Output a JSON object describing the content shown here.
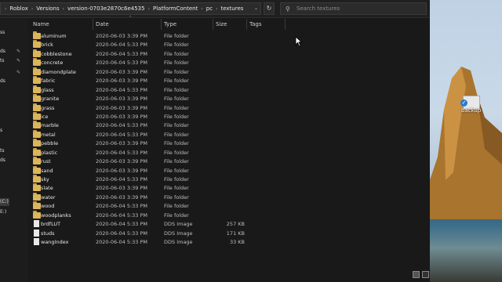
{
  "address": {
    "segments": [
      "Roblox",
      "Versions",
      "version-0703e2870c6e4535",
      "PlatformContent",
      "pc",
      "textures"
    ]
  },
  "search": {
    "placeholder": "Search textures"
  },
  "columns": {
    "name": "Name",
    "date": "Date",
    "type": "Type",
    "size": "Size",
    "tags": "Tags"
  },
  "nav": {
    "items": [
      "ss",
      "ds",
      "ts",
      "ds",
      "s",
      "ts",
      "ds",
      "(C:)",
      "E:)"
    ]
  },
  "desktop": {
    "icon_label": "backup"
  },
  "files": [
    {
      "name": "aluminum",
      "date": "2020-06-03 3:39 PM",
      "type": "File folder",
      "size": "",
      "kind": "folder"
    },
    {
      "name": "brick",
      "date": "2020-06-04 5:33 PM",
      "type": "File folder",
      "size": "",
      "kind": "folder"
    },
    {
      "name": "cobblestone",
      "date": "2020-06-04 5:33 PM",
      "type": "File folder",
      "size": "",
      "kind": "folder"
    },
    {
      "name": "concrete",
      "date": "2020-06-04 5:33 PM",
      "type": "File folder",
      "size": "",
      "kind": "folder"
    },
    {
      "name": "diamondplate",
      "date": "2020-06-03 3:39 PM",
      "type": "File folder",
      "size": "",
      "kind": "folder"
    },
    {
      "name": "fabric",
      "date": "2020-06-03 3:39 PM",
      "type": "File folder",
      "size": "",
      "kind": "folder"
    },
    {
      "name": "glass",
      "date": "2020-06-04 5:33 PM",
      "type": "File folder",
      "size": "",
      "kind": "folder"
    },
    {
      "name": "granite",
      "date": "2020-06-03 3:39 PM",
      "type": "File folder",
      "size": "",
      "kind": "folder"
    },
    {
      "name": "grass",
      "date": "2020-06-03 3:39 PM",
      "type": "File folder",
      "size": "",
      "kind": "folder"
    },
    {
      "name": "ice",
      "date": "2020-06-03 3:39 PM",
      "type": "File folder",
      "size": "",
      "kind": "folder"
    },
    {
      "name": "marble",
      "date": "2020-06-04 5:33 PM",
      "type": "File folder",
      "size": "",
      "kind": "folder"
    },
    {
      "name": "metal",
      "date": "2020-06-04 5:33 PM",
      "type": "File folder",
      "size": "",
      "kind": "folder"
    },
    {
      "name": "pebble",
      "date": "2020-06-03 3:39 PM",
      "type": "File folder",
      "size": "",
      "kind": "folder"
    },
    {
      "name": "plastic",
      "date": "2020-06-04 5:33 PM",
      "type": "File folder",
      "size": "",
      "kind": "folder"
    },
    {
      "name": "rust",
      "date": "2020-06-03 3:39 PM",
      "type": "File folder",
      "size": "",
      "kind": "folder"
    },
    {
      "name": "sand",
      "date": "2020-06-03 3:39 PM",
      "type": "File folder",
      "size": "",
      "kind": "folder"
    },
    {
      "name": "sky",
      "date": "2020-06-04 5:33 PM",
      "type": "File folder",
      "size": "",
      "kind": "folder"
    },
    {
      "name": "slate",
      "date": "2020-06-03 3:39 PM",
      "type": "File folder",
      "size": "",
      "kind": "folder"
    },
    {
      "name": "water",
      "date": "2020-06-03 3:39 PM",
      "type": "File folder",
      "size": "",
      "kind": "folder"
    },
    {
      "name": "wood",
      "date": "2020-06-04 5:33 PM",
      "type": "File folder",
      "size": "",
      "kind": "folder"
    },
    {
      "name": "woodplanks",
      "date": "2020-06-04 5:33 PM",
      "type": "File folder",
      "size": "",
      "kind": "folder"
    },
    {
      "name": "brdfLUT",
      "date": "2020-06-04 5:33 PM",
      "type": "DDS Image",
      "size": "257 KB",
      "kind": "file"
    },
    {
      "name": "studs",
      "date": "2020-06-04 5:33 PM",
      "type": "DDS Image",
      "size": "171 KB",
      "kind": "file"
    },
    {
      "name": "wangIndex",
      "date": "2020-06-04 5:33 PM",
      "type": "DDS Image",
      "size": "33 KB",
      "kind": "file"
    }
  ],
  "colors": {
    "folder": "#dcb55a",
    "background": "#191919",
    "text": "#e6e6e6"
  }
}
